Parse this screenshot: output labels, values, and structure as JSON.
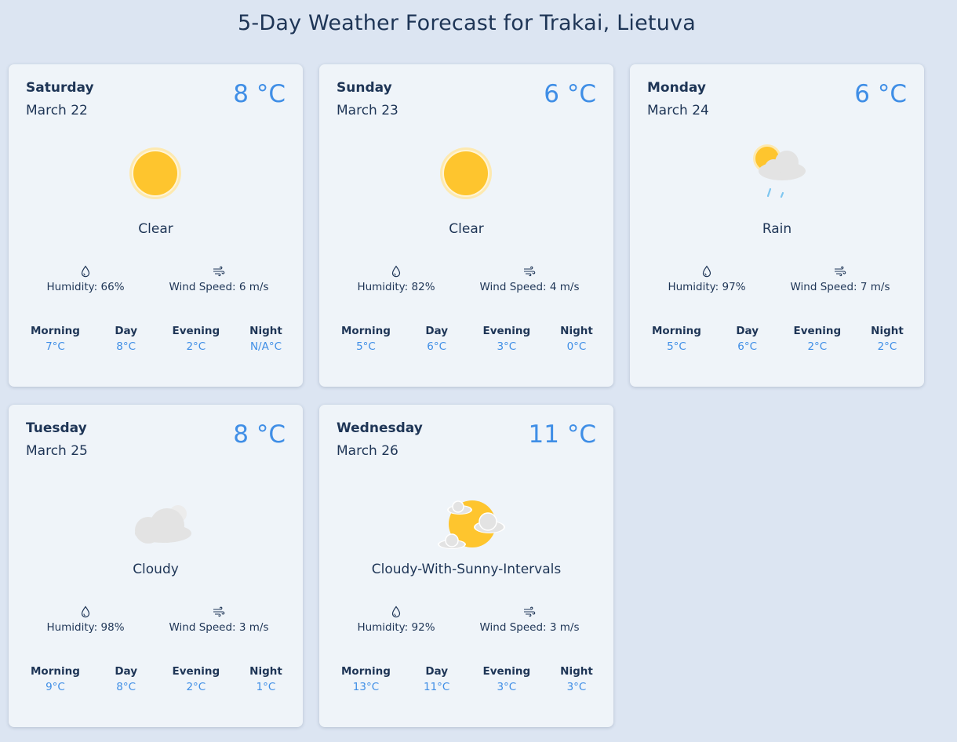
{
  "page": {
    "title": "5-Day Weather Forecast for Trakai, Lietuva"
  },
  "colors": {
    "background": "#dce5f2",
    "card": "#eff4f9",
    "text": "#1e3556",
    "accent": "#3f8ee6",
    "sun": "#fec52e",
    "cloud": "#e3e3e3"
  },
  "labels": {
    "morning": "Morning",
    "day": "Day",
    "evening": "Evening",
    "night": "Night"
  },
  "days": [
    {
      "name": "Saturday",
      "date": "March 22",
      "temp": "8 °C",
      "icon": "sun-icon",
      "condition": "Clear",
      "humidity": "Humidity: 66%",
      "wind": "Wind Speed: 6 m/s",
      "morning": "7°C",
      "day": "8°C",
      "evening": "2°C",
      "night": "N/A°C"
    },
    {
      "name": "Sunday",
      "date": "March 23",
      "temp": "6 °C",
      "icon": "sun-icon",
      "condition": "Clear",
      "humidity": "Humidity: 82%",
      "wind": "Wind Speed: 4 m/s",
      "morning": "5°C",
      "day": "6°C",
      "evening": "3°C",
      "night": "0°C"
    },
    {
      "name": "Monday",
      "date": "March 24",
      "temp": "6 °C",
      "icon": "rain-icon",
      "condition": "Rain",
      "humidity": "Humidity: 97%",
      "wind": "Wind Speed: 7 m/s",
      "morning": "5°C",
      "day": "6°C",
      "evening": "2°C",
      "night": "2°C"
    },
    {
      "name": "Tuesday",
      "date": "March 25",
      "temp": "8 °C",
      "icon": "cloud-icon",
      "condition": "Cloudy",
      "humidity": "Humidity: 98%",
      "wind": "Wind Speed: 3 m/s",
      "morning": "9°C",
      "day": "8°C",
      "evening": "2°C",
      "night": "1°C"
    },
    {
      "name": "Wednesday",
      "date": "March 26",
      "temp": "11 °C",
      "icon": "sun-with-clouds-icon",
      "condition": "Cloudy-With-Sunny-Intervals",
      "humidity": "Humidity: 92%",
      "wind": "Wind Speed: 3 m/s",
      "morning": "13°C",
      "day": "11°C",
      "evening": "3°C",
      "night": "3°C"
    }
  ]
}
